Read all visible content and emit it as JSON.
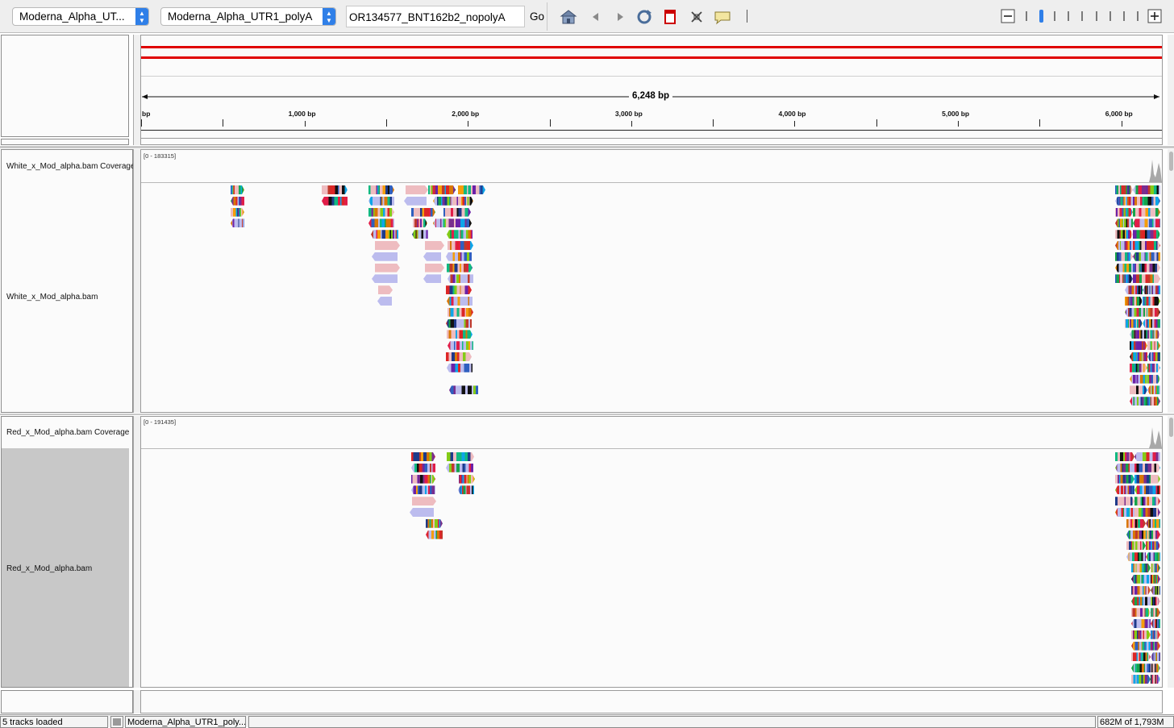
{
  "toolbar": {
    "genome_dropdown": "Moderna_Alpha_UT...",
    "chromosome_dropdown": "Moderna_Alpha_UTR1_polyA",
    "locus_value": "OR134577_BNT162b2_nopolyA",
    "go_label": "Go",
    "icons": [
      "home-icon",
      "back-icon",
      "forward-icon",
      "refresh-icon",
      "roi-icon",
      "fit-icon",
      "popup-icon"
    ],
    "zoom_levels": 10,
    "zoom_selected": 1
  },
  "ruler": {
    "span_label": "6,248 bp",
    "ticks": [
      {
        "label": "bp",
        "bp": 0
      },
      {
        "label": "1,000 bp",
        "bp": 1000
      },
      {
        "label": "2,000 bp",
        "bp": 2000
      },
      {
        "label": "3,000 bp",
        "bp": 3000
      },
      {
        "label": "4,000 bp",
        "bp": 4000
      },
      {
        "label": "5,000 bp",
        "bp": 5000
      },
      {
        "label": "6,000 bp",
        "bp": 6000
      }
    ],
    "total_bp": 6248
  },
  "tracks": {
    "white_coverage_label": "White_x_Mod_alpha.bam Coverage",
    "white_coverage_range": "[0 - 183315]",
    "white_bam_label": "White_x_Mod_alpha.bam",
    "red_coverage_label": "Red_x_Mod_alpha.bam Coverage",
    "red_coverage_range": "[0 - 191435]",
    "red_bam_label": "Red_x_Mod_alpha.bam"
  },
  "status": {
    "tracks_loaded": "5 tracks loaded",
    "locus": "Moderna_Alpha_UTR1_poly...",
    "memory": "682M of 1,793M"
  },
  "colors": {
    "accent": "#2f7fe8",
    "chrom_ideogram": "#e00000",
    "read_forward": "#eebcc0",
    "read_reverse": "#bcbcee",
    "selected_track_bg": "#c8c8c8"
  }
}
